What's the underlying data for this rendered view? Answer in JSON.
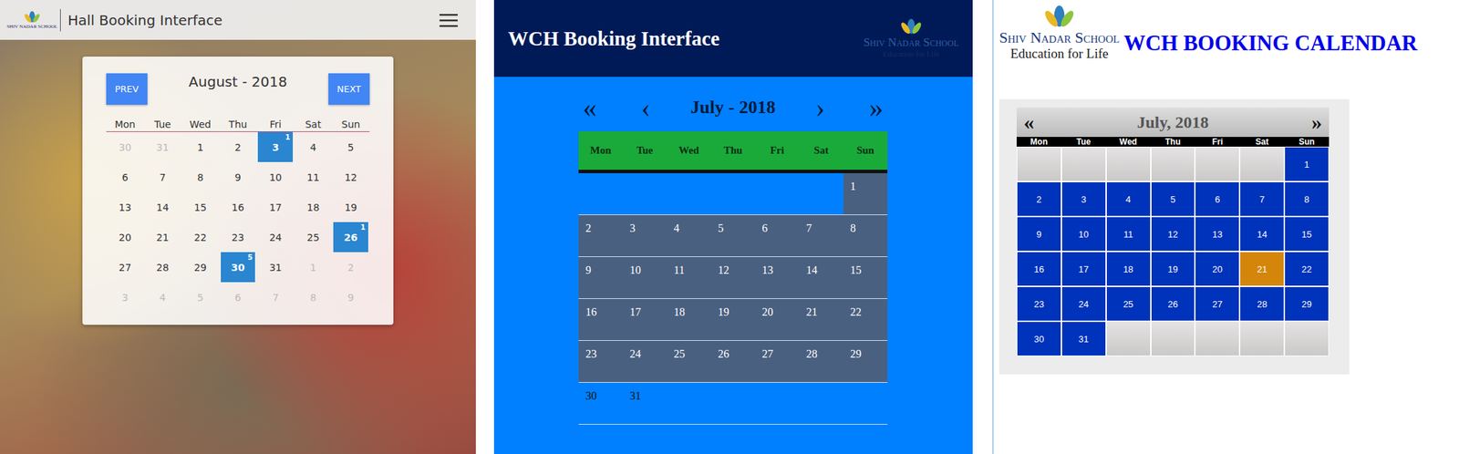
{
  "hall_interface": {
    "logo": "SHIV NADAR SCHOOL",
    "title": "Hall Booking Interface",
    "calendar": {
      "prev": "PREV",
      "next": "NEXT",
      "month": "August - 2018",
      "weekdays": [
        "Mon",
        "Tue",
        "Wed",
        "Thu",
        "Fri",
        "Sat",
        "Sun"
      ],
      "days": [
        {
          "day": "30",
          "muted": true,
          "selected": false
        },
        {
          "day": "31",
          "muted": true,
          "selected": false
        },
        {
          "day": "1",
          "muted": false,
          "selected": false
        },
        {
          "day": "2",
          "muted": false,
          "selected": false
        },
        {
          "day": "3",
          "muted": false,
          "selected": true,
          "count": "1"
        },
        {
          "day": "4",
          "muted": false,
          "selected": false
        },
        {
          "day": "5",
          "muted": false,
          "selected": false
        },
        {
          "day": "6",
          "muted": false,
          "selected": false
        },
        {
          "day": "7",
          "muted": false,
          "selected": false
        },
        {
          "day": "8",
          "muted": false,
          "selected": false
        },
        {
          "day": "9",
          "muted": false,
          "selected": false
        },
        {
          "day": "10",
          "muted": false,
          "selected": false
        },
        {
          "day": "11",
          "muted": false,
          "selected": false
        },
        {
          "day": "12",
          "muted": false,
          "selected": false
        },
        {
          "day": "13",
          "muted": false,
          "selected": false
        },
        {
          "day": "14",
          "muted": false,
          "selected": false
        },
        {
          "day": "15",
          "muted": false,
          "selected": false
        },
        {
          "day": "16",
          "muted": false,
          "selected": false
        },
        {
          "day": "17",
          "muted": false,
          "selected": false
        },
        {
          "day": "18",
          "muted": false,
          "selected": false
        },
        {
          "day": "19",
          "muted": false,
          "selected": false
        },
        {
          "day": "20",
          "muted": false,
          "selected": false
        },
        {
          "day": "21",
          "muted": false,
          "selected": false
        },
        {
          "day": "22",
          "muted": false,
          "selected": false
        },
        {
          "day": "23",
          "muted": false,
          "selected": false
        },
        {
          "day": "24",
          "muted": false,
          "selected": false
        },
        {
          "day": "25",
          "muted": false,
          "selected": false
        },
        {
          "day": "26",
          "muted": false,
          "selected": true,
          "count": "1"
        },
        {
          "day": "27",
          "muted": false,
          "selected": false
        },
        {
          "day": "28",
          "muted": false,
          "selected": false
        },
        {
          "day": "29",
          "muted": false,
          "selected": false
        },
        {
          "day": "30",
          "muted": false,
          "selected": true,
          "count": "5"
        },
        {
          "day": "31",
          "muted": false,
          "selected": false
        },
        {
          "day": "1",
          "muted": true,
          "selected": false
        },
        {
          "day": "2",
          "muted": true,
          "selected": false
        },
        {
          "day": "3",
          "muted": true,
          "selected": false
        },
        {
          "day": "4",
          "muted": true,
          "selected": false
        },
        {
          "day": "5",
          "muted": true,
          "selected": false
        },
        {
          "day": "6",
          "muted": true,
          "selected": false
        },
        {
          "day": "7",
          "muted": true,
          "selected": false
        },
        {
          "day": "8",
          "muted": true,
          "selected": false
        },
        {
          "day": "9",
          "muted": true,
          "selected": false
        }
      ]
    }
  },
  "wch_interface": {
    "title": "WCH Booking Interface",
    "logo": [
      "Shiv Nadar School",
      "Education for Life"
    ],
    "nav": {
      "first": "«",
      "prev": "‹",
      "month": "July - 2018",
      "next": "›",
      "last": "»"
    },
    "weekdays": [
      "Mon",
      "Tue",
      "Wed",
      "Thu",
      "Fri",
      "Sat",
      "Sun"
    ],
    "weeks": [
      [
        {
          "day": "",
          "shaded": false
        },
        {
          "day": "",
          "shaded": false
        },
        {
          "day": "",
          "shaded": false
        },
        {
          "day": "",
          "shaded": false
        },
        {
          "day": "",
          "shaded": false
        },
        {
          "day": "",
          "shaded": false
        },
        {
          "day": "1",
          "shaded": true
        }
      ],
      [
        {
          "day": "2",
          "shaded": true
        },
        {
          "day": "3",
          "shaded": true
        },
        {
          "day": "4",
          "shaded": true
        },
        {
          "day": "5",
          "shaded": true
        },
        {
          "day": "6",
          "shaded": true
        },
        {
          "day": "7",
          "shaded": true
        },
        {
          "day": "8",
          "shaded": true
        }
      ],
      [
        {
          "day": "9",
          "shaded": true
        },
        {
          "day": "10",
          "shaded": true
        },
        {
          "day": "11",
          "shaded": true
        },
        {
          "day": "12",
          "shaded": true
        },
        {
          "day": "13",
          "shaded": true
        },
        {
          "day": "14",
          "shaded": true
        },
        {
          "day": "15",
          "shaded": true
        }
      ],
      [
        {
          "day": "16",
          "shaded": true
        },
        {
          "day": "17",
          "shaded": true
        },
        {
          "day": "18",
          "shaded": true
        },
        {
          "day": "19",
          "shaded": true
        },
        {
          "day": "20",
          "shaded": true
        },
        {
          "day": "21",
          "shaded": true
        },
        {
          "day": "22",
          "shaded": true
        }
      ],
      [
        {
          "day": "23",
          "shaded": true
        },
        {
          "day": "24",
          "shaded": true
        },
        {
          "day": "25",
          "shaded": true
        },
        {
          "day": "26",
          "shaded": true
        },
        {
          "day": "27",
          "shaded": true
        },
        {
          "day": "28",
          "shaded": true
        },
        {
          "day": "29",
          "shaded": true
        }
      ],
      [
        {
          "day": "30",
          "shaded": false
        },
        {
          "day": "31",
          "shaded": false
        },
        {
          "day": "",
          "shaded": false
        },
        {
          "day": "",
          "shaded": false
        },
        {
          "day": "",
          "shaded": false
        },
        {
          "day": "",
          "shaded": false
        },
        {
          "day": "",
          "shaded": false
        }
      ]
    ]
  },
  "wch_calendar": {
    "logo": [
      "Shiv Nadar School",
      "Education for Life"
    ],
    "title": "WCH BOOKING CALENDAR",
    "prev": "«",
    "month": "July, 2018",
    "next": "»",
    "weekdays": [
      "Mon",
      "Tue",
      "Wed",
      "Thu",
      "Fri",
      "Sat",
      "Sun"
    ],
    "cells": [
      {
        "day": "",
        "selected": false
      },
      {
        "day": "",
        "selected": false
      },
      {
        "day": "",
        "selected": false
      },
      {
        "day": "",
        "selected": false
      },
      {
        "day": "",
        "selected": false
      },
      {
        "day": "",
        "selected": false
      },
      {
        "day": "1",
        "selected": false
      },
      {
        "day": "2",
        "selected": false
      },
      {
        "day": "3",
        "selected": false
      },
      {
        "day": "4",
        "selected": false
      },
      {
        "day": "5",
        "selected": false
      },
      {
        "day": "6",
        "selected": false
      },
      {
        "day": "7",
        "selected": false
      },
      {
        "day": "8",
        "selected": false
      },
      {
        "day": "9",
        "selected": false
      },
      {
        "day": "10",
        "selected": false
      },
      {
        "day": "11",
        "selected": false
      },
      {
        "day": "12",
        "selected": false
      },
      {
        "day": "13",
        "selected": false
      },
      {
        "day": "14",
        "selected": false
      },
      {
        "day": "15",
        "selected": false
      },
      {
        "day": "16",
        "selected": false
      },
      {
        "day": "17",
        "selected": false
      },
      {
        "day": "18",
        "selected": false
      },
      {
        "day": "19",
        "selected": false
      },
      {
        "day": "20",
        "selected": false
      },
      {
        "day": "21",
        "selected": true
      },
      {
        "day": "22",
        "selected": false
      },
      {
        "day": "23",
        "selected": false
      },
      {
        "day": "24",
        "selected": false
      },
      {
        "day": "25",
        "selected": false
      },
      {
        "day": "26",
        "selected": false
      },
      {
        "day": "27",
        "selected": false
      },
      {
        "day": "28",
        "selected": false
      },
      {
        "day": "29",
        "selected": false
      },
      {
        "day": "30",
        "selected": false
      },
      {
        "day": "31",
        "selected": false
      },
      {
        "day": "",
        "selected": false
      },
      {
        "day": "",
        "selected": false
      },
      {
        "day": "",
        "selected": false
      },
      {
        "day": "",
        "selected": false
      },
      {
        "day": "",
        "selected": false
      }
    ]
  }
}
